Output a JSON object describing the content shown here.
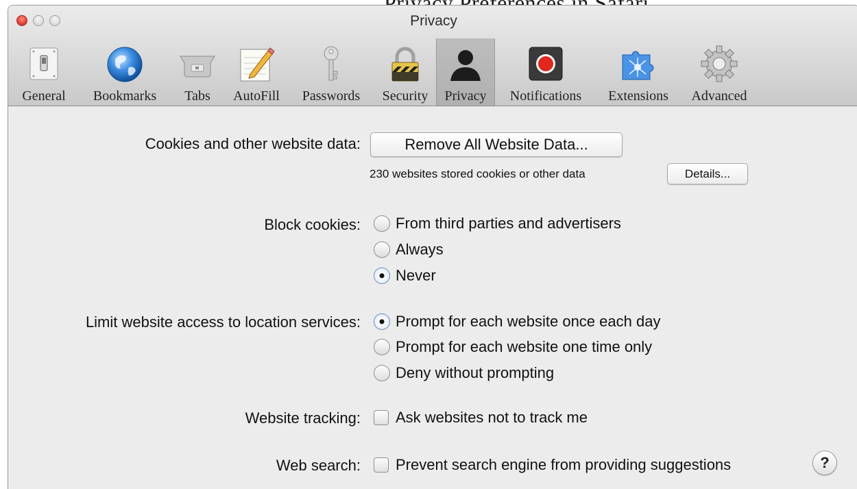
{
  "background_text": "Privacy Preferences in Safari",
  "window": {
    "title": "Privacy"
  },
  "toolbar": {
    "items": [
      {
        "label": "General",
        "icon": "general-switch-icon"
      },
      {
        "label": "Bookmarks",
        "icon": "globe-icon"
      },
      {
        "label": "Tabs",
        "icon": "tabs-icon"
      },
      {
        "label": "AutoFill",
        "icon": "autofill-pencil-icon"
      },
      {
        "label": "Passwords",
        "icon": "key-icon"
      },
      {
        "label": "Security",
        "icon": "padlock-icon"
      },
      {
        "label": "Privacy",
        "icon": "silhouette-icon",
        "selected": true
      },
      {
        "label": "Notifications",
        "icon": "record-icon"
      },
      {
        "label": "Extensions",
        "icon": "puzzle-icon"
      },
      {
        "label": "Advanced",
        "icon": "gear-icon"
      }
    ]
  },
  "cookies": {
    "label": "Cookies and other website data:",
    "remove_button": "Remove All Website Data...",
    "stored_text": "230 websites stored cookies or other data",
    "details_button": "Details..."
  },
  "block_cookies": {
    "label": "Block cookies:",
    "options": [
      "From third parties and advertisers",
      "Always",
      "Never"
    ],
    "selected": "Never"
  },
  "location": {
    "label": "Limit website access to location services:",
    "options": [
      "Prompt for each website once each day",
      "Prompt for each website one time only",
      "Deny without prompting"
    ],
    "selected": "Prompt for each website once each day"
  },
  "tracking": {
    "label": "Website tracking:",
    "checkbox_label": "Ask websites not to track me",
    "checked": false
  },
  "web_search": {
    "label": "Web search:",
    "checkbox_label": "Prevent search engine from providing suggestions",
    "checked": false
  },
  "help": {
    "label": "?"
  }
}
